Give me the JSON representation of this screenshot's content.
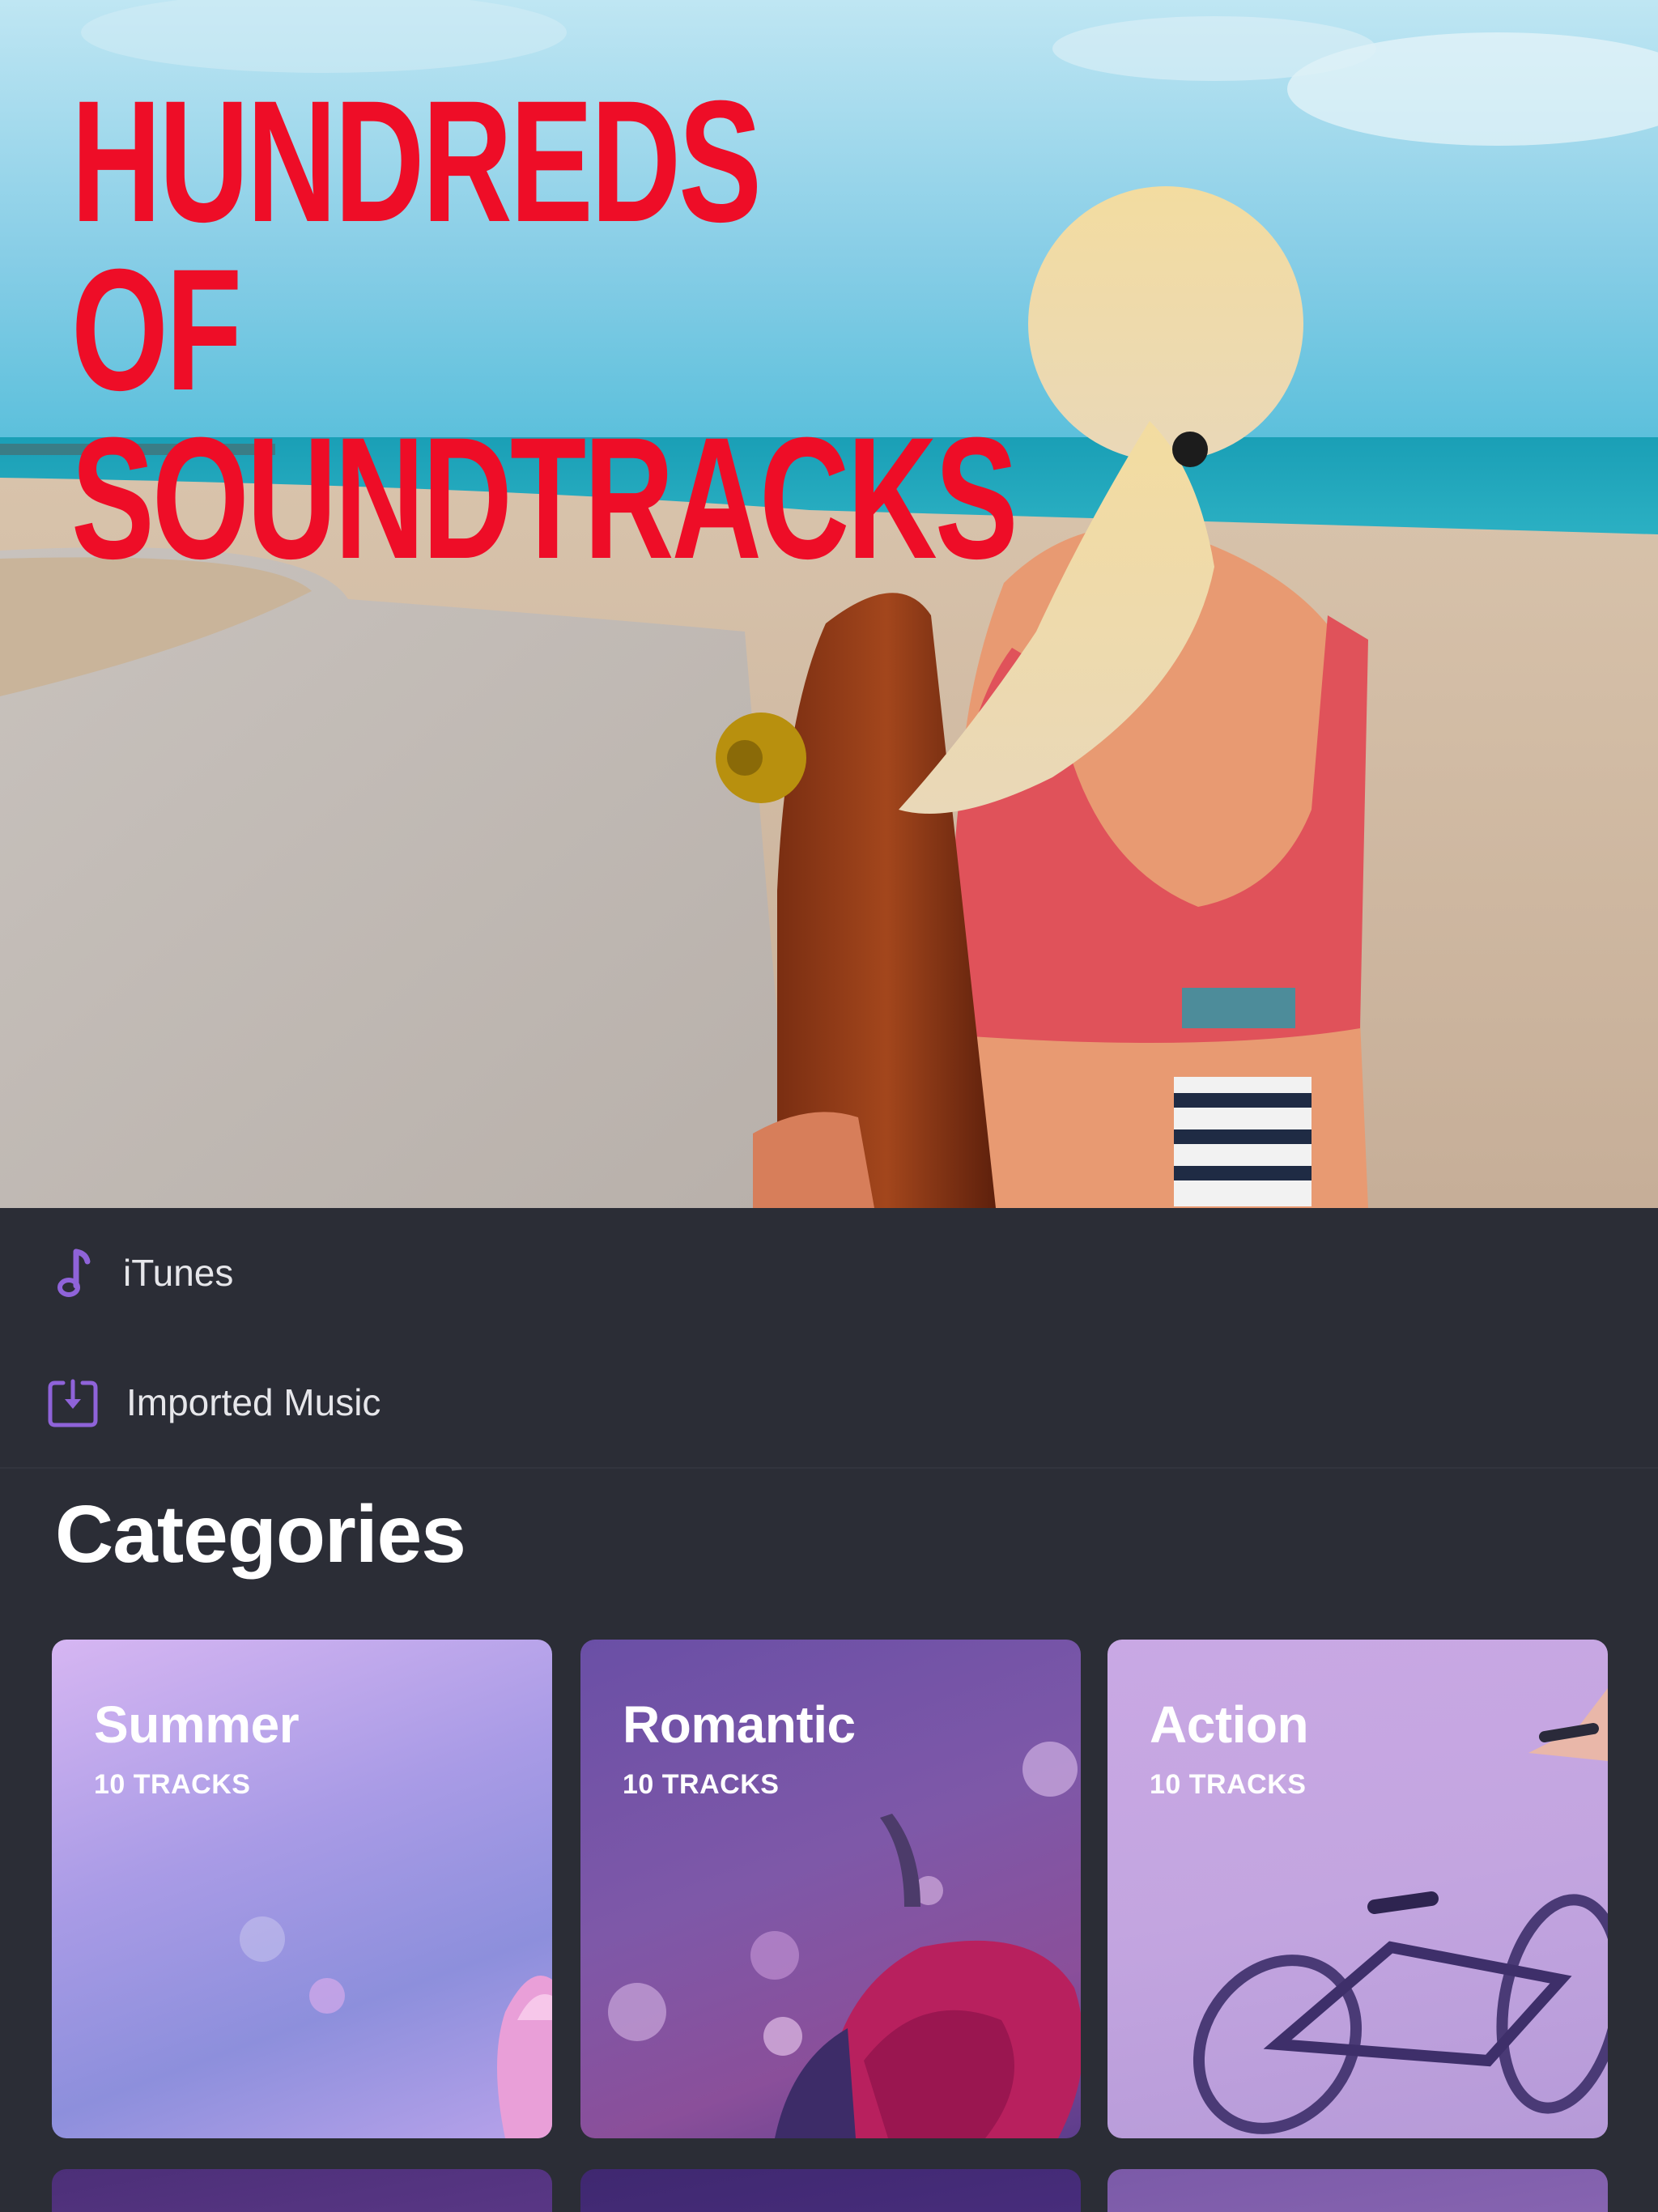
{
  "hero": {
    "title_line1": "HUNDREDS OF",
    "title_line2": "SOUNDTRACKS",
    "title_color": "#ee0d27"
  },
  "sources": [
    {
      "label": "iTunes",
      "icon": "music-note-icon"
    },
    {
      "label": "Imported Music",
      "icon": "import-download-icon"
    }
  ],
  "accent_color": "#8f63d9",
  "categories": {
    "title": "Categories",
    "items": [
      {
        "title": "Summer",
        "count": "10 TRACKS"
      },
      {
        "title": "Romantic",
        "count": "10 TRACKS"
      },
      {
        "title": "Action",
        "count": "10 TRACKS"
      },
      {
        "title": "",
        "count": ""
      },
      {
        "title": "",
        "count": ""
      },
      {
        "title": "",
        "count": ""
      }
    ]
  }
}
